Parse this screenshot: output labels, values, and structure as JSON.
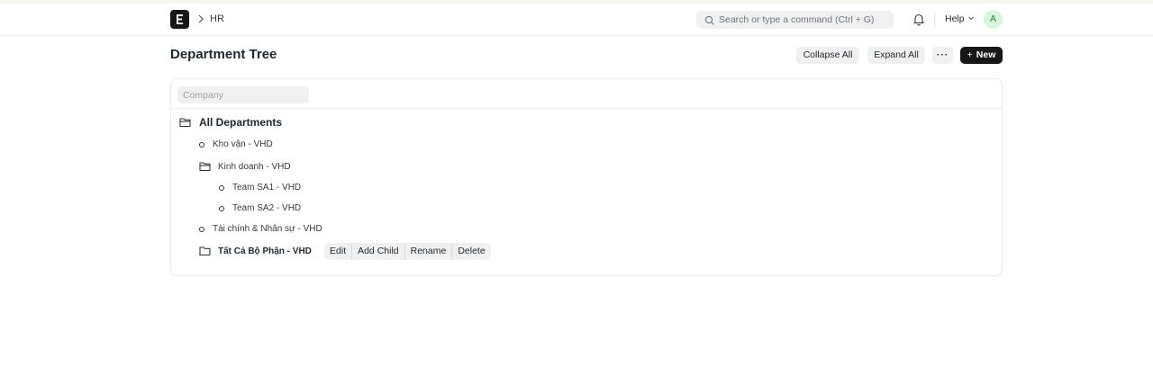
{
  "navbar": {
    "breadcrumb": "HR",
    "search_placeholder": "Search or type a command (Ctrl + G)",
    "help_label": "Help",
    "avatar_initial": "A",
    "avatar_color": "#d7f6dd"
  },
  "page": {
    "title": "Department Tree",
    "collapse_all_label": "Collapse All",
    "expand_all_label": "Expand All",
    "more_label": "···",
    "new_label": "New"
  },
  "filter": {
    "company_placeholder": "Company"
  },
  "tree": {
    "root": "All Departments",
    "items": [
      {
        "label": "Kho vận - VHD",
        "type": "leaf"
      },
      {
        "label": "Kinh doanh - VHD",
        "type": "group"
      },
      {
        "label": "Team SA1 - VHD",
        "type": "leaf"
      },
      {
        "label": "Team SA2 - VHD",
        "type": "leaf"
      },
      {
        "label": "Tài chính & Nhân sự - VHD",
        "type": "leaf"
      },
      {
        "label": "Tất Cả Bộ Phận - VHD",
        "type": "group",
        "selected": true
      }
    ],
    "actions": [
      "Edit",
      "Add Child",
      "Rename",
      "Delete"
    ]
  },
  "colors": {
    "primary_button": "#171717",
    "button_bg": "#f0f0f0"
  }
}
